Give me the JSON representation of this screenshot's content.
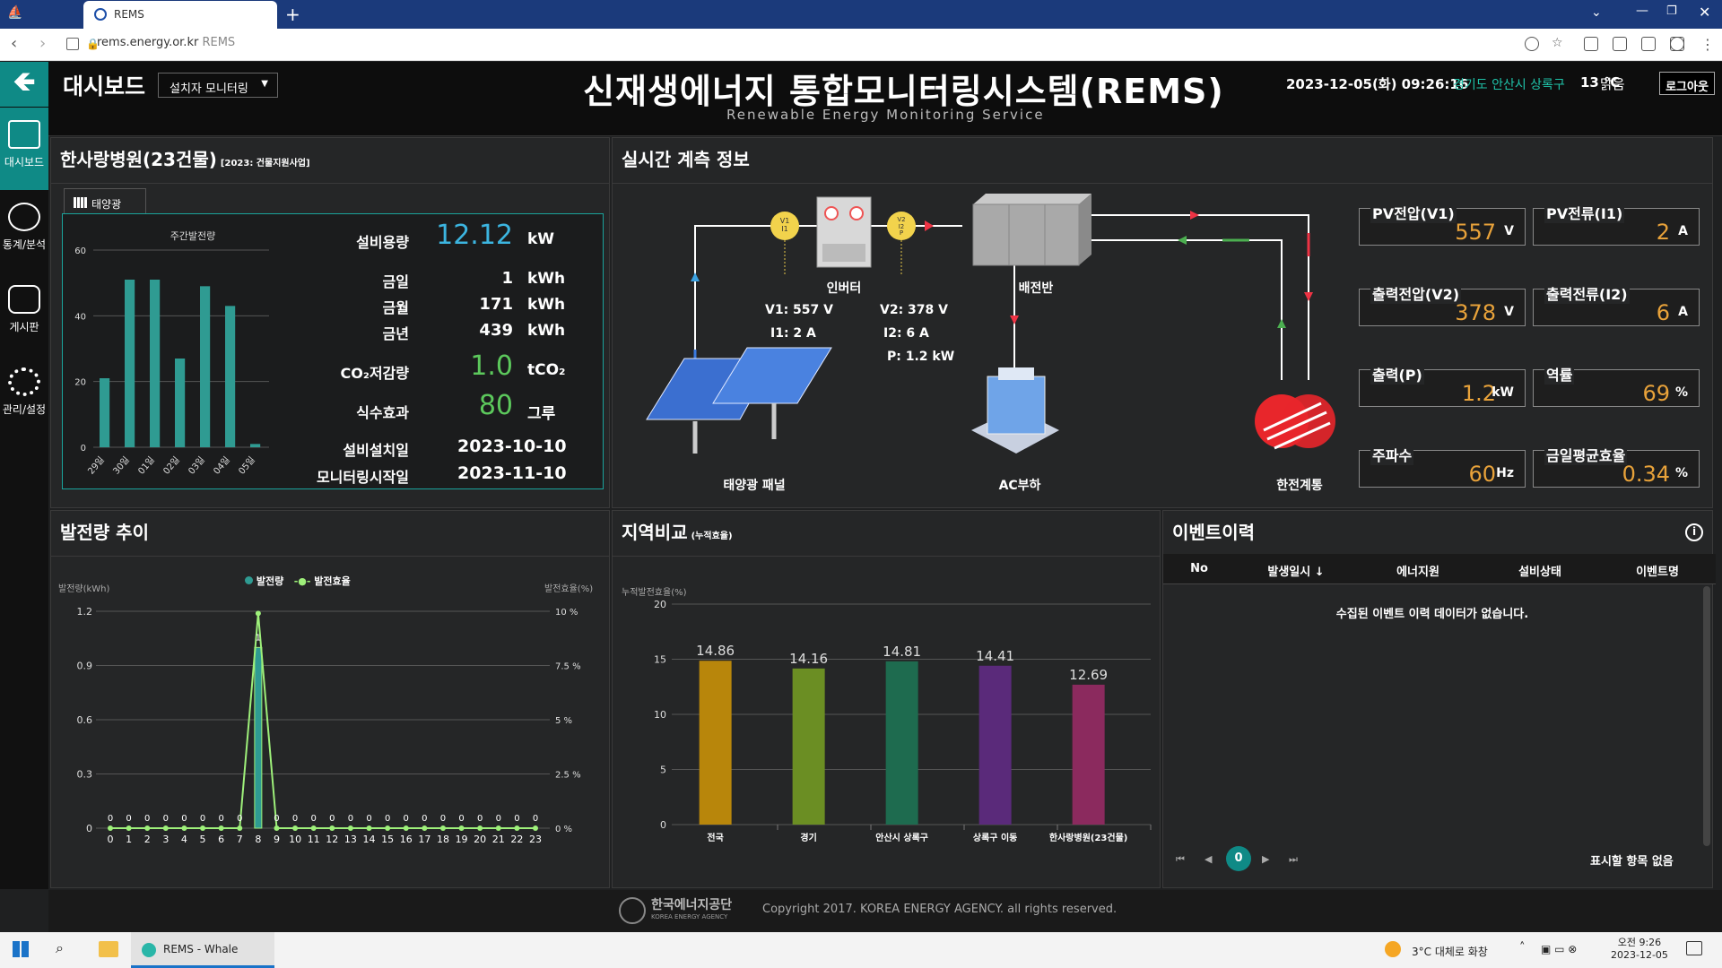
{
  "browser": {
    "tab_title": "REMS",
    "url": "rems.energy.or.kr",
    "url_suffix": "REMS"
  },
  "header": {
    "dashboard_label": "대시보드",
    "install_select": "설치자 모니터링",
    "system_title": "신재생에너지 통합모니터링시스템(REMS)",
    "system_subtitle": "Renewable Energy Monitoring Service",
    "datetime": "2023-12-05(화) 09:26:16",
    "location": "경기도 안산시 상록구",
    "temperature": "13 ℃",
    "weather": "맑음",
    "logout": "로그아웃"
  },
  "sidebar": {
    "items": [
      {
        "label": "대시보드",
        "icon": "monitor-icon"
      },
      {
        "label": "통계/분석",
        "icon": "chart-search-icon"
      },
      {
        "label": "게시판",
        "icon": "chat-icon"
      },
      {
        "label": "관리/설정",
        "icon": "gear-icon"
      }
    ]
  },
  "facility": {
    "title": "한사랑병원(23건물)",
    "subtitle": "[2023: 건물지원사업]",
    "tab": "태양광",
    "chart_title": "주간발전량",
    "capacity_label": "설비용량",
    "capacity": "12.12",
    "capacity_unit": "kW",
    "rows": [
      {
        "label": "금일",
        "value": "1",
        "unit": "kWh"
      },
      {
        "label": "금월",
        "value": "171",
        "unit": "kWh"
      },
      {
        "label": "금년",
        "value": "439",
        "unit": "kWh"
      }
    ],
    "co2_label": "CO₂저감량",
    "co2": "1.0",
    "co2_unit": "tCO₂",
    "tree_label": "식수효과",
    "tree": "80",
    "tree_unit": "그루",
    "install_date_label": "설비설치일",
    "install_date": "2023-10-10",
    "monitor_date_label": "모니터링시작일",
    "monitor_date": "2023-11-10"
  },
  "chart_data": [
    {
      "type": "bar",
      "title": "주간발전량",
      "categories": [
        "29일",
        "30일",
        "01일",
        "02일",
        "03일",
        "04일",
        "05일"
      ],
      "values": [
        21,
        51,
        51,
        27,
        49,
        43,
        1
      ],
      "ylim": [
        0,
        60
      ],
      "yticks": [
        0,
        20,
        40,
        60
      ],
      "color": "#2f9b92"
    },
    {
      "type": "line",
      "title": "발전량 추이",
      "series": [
        {
          "name": "발전량",
          "color": "#2f9b92",
          "values": [
            0,
            0,
            0,
            0,
            0,
            0,
            0,
            0,
            1,
            0,
            0,
            0,
            0,
            0,
            0,
            0,
            0,
            0,
            0,
            0,
            0,
            0,
            0,
            0
          ]
        },
        {
          "name": "발전효율",
          "color": "#9ef07a",
          "values": [
            0,
            0,
            0,
            0,
            0,
            0,
            0,
            0,
            9.9,
            0,
            0,
            0,
            0,
            0,
            0,
            0,
            0,
            0,
            0,
            0,
            0,
            0,
            0,
            0
          ]
        }
      ],
      "x": [
        0,
        1,
        2,
        3,
        4,
        5,
        6,
        7,
        8,
        9,
        10,
        11,
        12,
        13,
        14,
        15,
        16,
        17,
        18,
        19,
        20,
        21,
        22,
        23
      ],
      "ylabel": "발전량(kWh)",
      "y2label": "발전효율(%)",
      "ylim": [
        0,
        1.2
      ],
      "yticks": [
        "0",
        "0.3",
        "0.6",
        "0.9",
        "1.2"
      ],
      "y2ticks": [
        "0 %",
        "2.5 %",
        "5 %",
        "7.5 %",
        "10 %"
      ],
      "point_labels": [
        "0",
        "0",
        "0",
        "0",
        "0",
        "0",
        "0",
        "0",
        "1",
        "0",
        "0",
        "0",
        "0",
        "0",
        "0",
        "0",
        "0",
        "0",
        "0",
        "0",
        "0",
        "0",
        "0",
        "0"
      ]
    },
    {
      "type": "bar",
      "title": "지역비교",
      "categories": [
        "전국",
        "경기",
        "안산시 상록구",
        "상록구 이동",
        "한사랑병원(23건물)"
      ],
      "values": [
        14.86,
        14.16,
        14.81,
        14.41,
        12.69
      ],
      "colors": [
        "#b8860b",
        "#6b8e23",
        "#1e6b4f",
        "#5a2a7a",
        "#8b2a5e"
      ],
      "ylabel": "누적발전효율(%)",
      "ylim": [
        0,
        20
      ],
      "yticks": [
        0,
        5,
        10,
        15,
        20
      ]
    }
  ],
  "power_trend": {
    "title": "발전량 추이",
    "legend": [
      "발전량",
      "발전효율"
    ],
    "ylabel": "발전량(kWh)",
    "y2label": "발전효율(%)"
  },
  "region": {
    "title": "지역비교",
    "title_small": "(누적효율)",
    "ylabel": "누적발전효율(%)"
  },
  "live": {
    "title": "실시간 계측 정보",
    "inverter": "인버터",
    "panel_board": "배전반",
    "solar_panel": "태양광 패널",
    "ac_load": "AC부하",
    "kepco": "한전계통",
    "v1": "V1: 557 V",
    "i1": "I1: 2 A",
    "v2": "V2: 378 V",
    "i2": "I2: 6 A",
    "p": "P: 1.2 kW",
    "readings": [
      {
        "label": "PV전압(V1)",
        "value": "557",
        "unit": "V"
      },
      {
        "label": "PV전류(I1)",
        "value": "2",
        "unit": "A"
      },
      {
        "label": "출력전압(V2)",
        "value": "378",
        "unit": "V"
      },
      {
        "label": "출력전류(I2)",
        "value": "6",
        "unit": "A"
      },
      {
        "label": "출력(P)",
        "value": "1.2",
        "unit": "kW"
      },
      {
        "label": "역률",
        "value": "69",
        "unit": "%"
      },
      {
        "label": "주파수",
        "value": "60",
        "unit": "Hz"
      },
      {
        "label": "금일평균효율",
        "value": "0.34",
        "unit": "%"
      }
    ]
  },
  "events": {
    "title": "이벤트이력",
    "columns": [
      "No",
      "발생일시 ↓",
      "에너지원",
      "설비상태",
      "이벤트명"
    ],
    "empty": "수집된 이벤트 이력 데이터가 없습니다.",
    "page": "0",
    "no_items": "표시할 항목 없음"
  },
  "footer": {
    "org": "한국에너지공단",
    "org_en": "KOREA ENERGY AGENCY",
    "copyright": "Copyright 2017. KOREA ENERGY AGENCY. all rights reserved."
  },
  "taskbar": {
    "app": "REMS - Whale",
    "weather": "3°C  대체로 화창",
    "time": "오전 9:26",
    "date": "2023-12-05"
  }
}
